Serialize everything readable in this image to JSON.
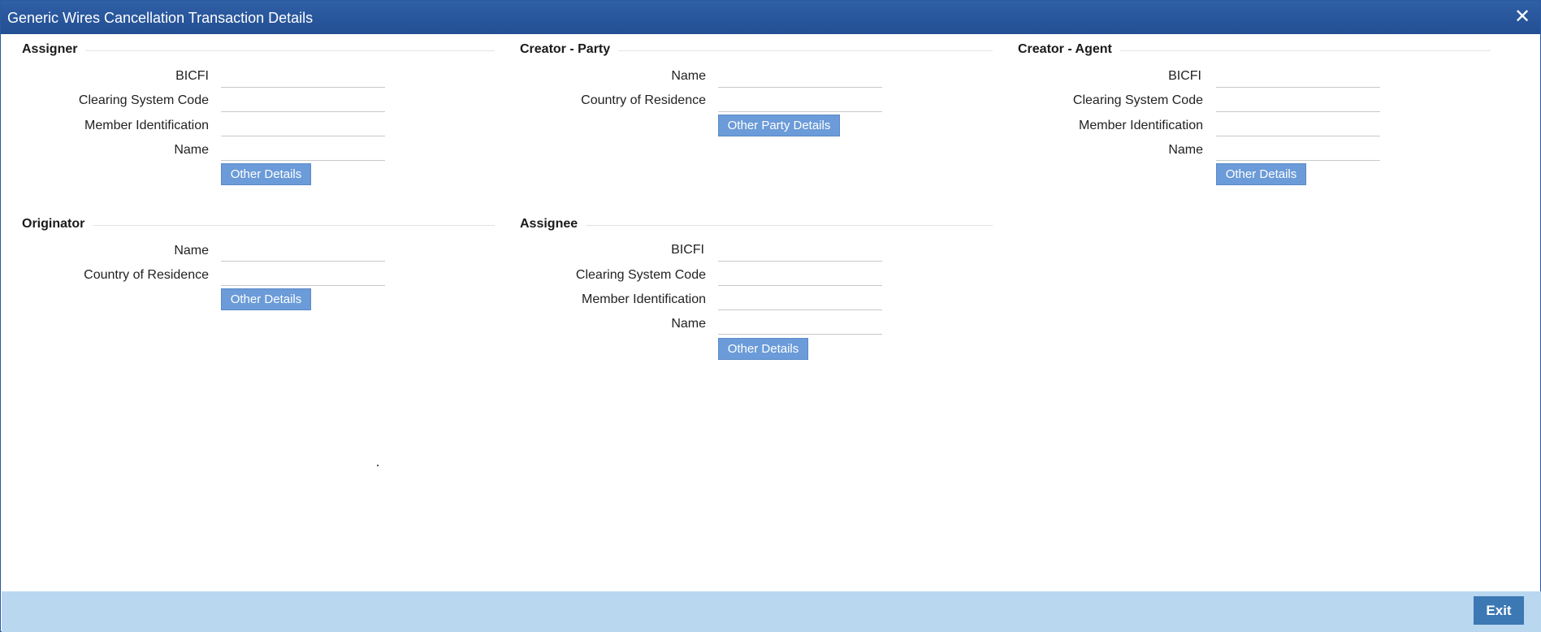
{
  "window": {
    "title": "Generic Wires Cancellation Transaction Details",
    "close_label": "✕"
  },
  "assigner": {
    "title": "Assigner",
    "fields": [
      {
        "label": "BICFI",
        "value": ""
      },
      {
        "label": "Clearing System Code",
        "value": ""
      },
      {
        "label": "Member Identification",
        "value": ""
      },
      {
        "label": "Name",
        "value": ""
      }
    ],
    "button": "Other Details"
  },
  "creator_party": {
    "title": "Creator - Party",
    "fields": [
      {
        "label": "Name",
        "value": ""
      },
      {
        "label": "Country of Residence",
        "value": ""
      }
    ],
    "button": "Other Party Details"
  },
  "creator_agent": {
    "title": "Creator - Agent",
    "fields": [
      {
        "label": "BICFI",
        "value": ""
      },
      {
        "label": "Clearing System Code",
        "value": ""
      },
      {
        "label": "Member Identification",
        "value": ""
      },
      {
        "label": "Name",
        "value": ""
      }
    ],
    "button": "Other Details"
  },
  "originator": {
    "title": "Originator",
    "fields": [
      {
        "label": "Name",
        "value": ""
      },
      {
        "label": "Country of Residence",
        "value": ""
      }
    ],
    "button": "Other Details"
  },
  "assignee": {
    "title": "Assignee",
    "fields": [
      {
        "label": "BICFI",
        "value": ""
      },
      {
        "label": "Clearing System Code",
        "value": ""
      },
      {
        "label": "Member Identification",
        "value": ""
      },
      {
        "label": "Name",
        "value": ""
      }
    ],
    "button": "Other Details"
  },
  "footer": {
    "exit_label": "Exit"
  },
  "colors": {
    "titlebar": "#2f5fa6",
    "button": "#6b9bd8",
    "footer": "#b9d7ef",
    "exit_button": "#3c78b4"
  }
}
